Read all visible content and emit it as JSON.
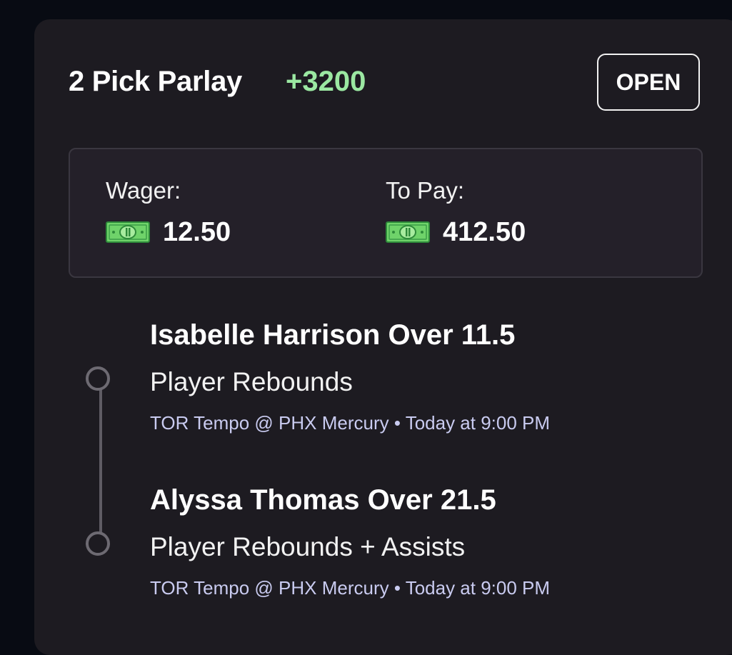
{
  "header": {
    "title": "2 Pick Parlay",
    "odds": "+3200",
    "status_label": "OPEN"
  },
  "summary": {
    "wager_label": "Wager:",
    "wager_amount": "12.50",
    "topay_label": "To Pay:",
    "topay_amount": "412.50",
    "currency_icon": "cash-icon"
  },
  "legs": [
    {
      "title": "Isabelle Harrison Over 11.5",
      "market": "Player Rebounds",
      "game": "TOR Tempo @ PHX Mercury • Today at 9:00 PM"
    },
    {
      "title": "Alyssa Thomas Over 21.5",
      "market": "Player Rebounds + Assists",
      "game": "TOR Tempo @ PHX Mercury • Today at 9:00 PM"
    }
  ],
  "colors": {
    "background": "#080b13",
    "card": "#1d1b21",
    "accent_green": "#9be8a2",
    "game_text": "#c9cbf0"
  }
}
